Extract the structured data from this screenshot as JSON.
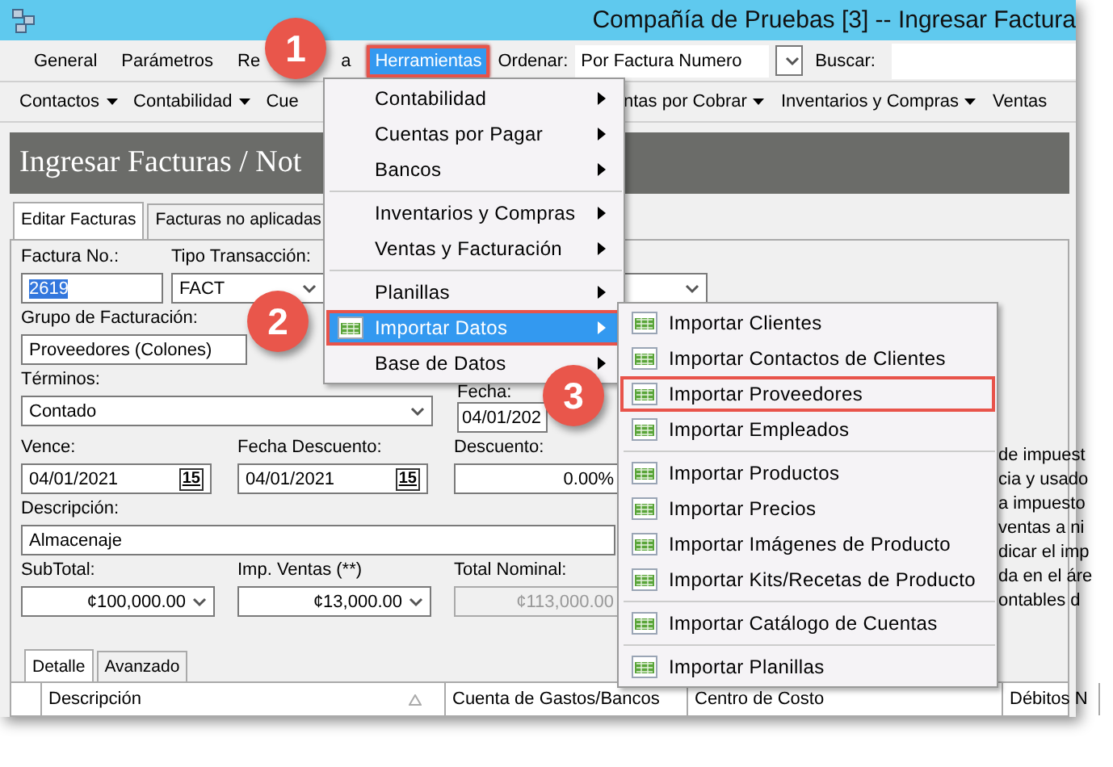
{
  "window": {
    "title": "Compañía de Pruebas [3] -- Ingresar Factura"
  },
  "menu_bar": {
    "items": [
      {
        "label": "General",
        "selected": false,
        "callout": false
      },
      {
        "label": "Parámetros",
        "selected": false,
        "callout": false
      },
      {
        "label": "Re",
        "label_end": "a",
        "selected": false,
        "callout": false
      },
      {
        "label": "Herramientas",
        "selected": true,
        "callout": true
      }
    ],
    "sort_label": "Ordenar:",
    "sort_value": "Por Factura Numero",
    "search_label": "Buscar:"
  },
  "toolbar": {
    "left": [
      "Contactos",
      "Contabilidad",
      "Cue"
    ],
    "right": [
      "ntas por Cobrar",
      "Inventarios y Compras",
      "Ventas"
    ]
  },
  "heading": "Ingresar Facturas / Not",
  "tabs": [
    {
      "label": "Editar Facturas",
      "selected": true
    },
    {
      "label": "Facturas no aplicadas",
      "selected": false
    }
  ],
  "form": {
    "invoice_no": {
      "label": "Factura No.:",
      "value": "2619"
    },
    "transaction_type": {
      "label": "Tipo Transacción:",
      "value": "FACT"
    },
    "billing_group": {
      "label": "Grupo de Facturación:",
      "value": "Proveedores (Colones)"
    },
    "terms": {
      "label": "Términos:",
      "value": "Contado"
    },
    "date": {
      "label": "Fecha:",
      "value": "04/01/202"
    },
    "due": {
      "label": "Vence:",
      "value": "04/01/2021",
      "calendar": "15"
    },
    "discount_date": {
      "label": "Fecha Descuento:",
      "value": "04/01/2021",
      "calendar": "15"
    },
    "discount": {
      "label": "Descuento:",
      "value": "0.00%"
    },
    "description": {
      "label": "Descripción:",
      "value": "Almacenaje"
    },
    "subtotal": {
      "label": "SubTotal:",
      "value": "¢100,000.00"
    },
    "sales_tax": {
      "label": "Imp. Ventas (**)",
      "value": "¢13,000.00"
    },
    "total": {
      "label": "Total Nominal:",
      "value": "¢113,000.00",
      "disabled": true
    }
  },
  "help_text": [
    "de impuest",
    "cia y usado",
    "a impuesto",
    "ventas a ni",
    "dicar el imp",
    "da en el áre",
    "ontables d"
  ],
  "detail_tabs": [
    {
      "label": "Detalle",
      "selected": true
    },
    {
      "label": "Avanzado",
      "selected": false
    }
  ],
  "grid": {
    "columns": [
      "Descripción",
      "Cuenta de Gastos/Bancos",
      "Centro de Costo",
      "Débitos N"
    ]
  },
  "tools_menu": [
    {
      "kind": "item",
      "label": "Contabilidad",
      "selected": false,
      "callout": false
    },
    {
      "kind": "item",
      "label": "Cuentas por Pagar",
      "selected": false,
      "callout": false
    },
    {
      "kind": "item",
      "label": "Bancos",
      "selected": false,
      "callout": false
    },
    {
      "kind": "separator"
    },
    {
      "kind": "item",
      "label": "Inventarios y Compras",
      "selected": false,
      "callout": false
    },
    {
      "kind": "item",
      "label": "Ventas y Facturación",
      "selected": false,
      "callout": false
    },
    {
      "kind": "separator"
    },
    {
      "kind": "item",
      "label": "Planillas",
      "selected": false,
      "callout": false
    },
    {
      "kind": "icon_item",
      "label": "Importar Datos",
      "selected": true,
      "callout": true
    },
    {
      "kind": "item",
      "label": "Base de Datos",
      "selected": false,
      "callout": false
    }
  ],
  "import_menu": [
    {
      "kind": "icon_item",
      "label": "Importar Clientes",
      "callout": false
    },
    {
      "kind": "icon_item",
      "label": "Importar Contactos de Clientes",
      "callout": false
    },
    {
      "kind": "icon_item",
      "label": "Importar Proveedores",
      "callout": true
    },
    {
      "kind": "icon_item",
      "label": "Importar Empleados",
      "callout": false
    },
    {
      "kind": "separator"
    },
    {
      "kind": "icon_item",
      "label": "Importar Productos",
      "callout": false
    },
    {
      "kind": "icon_item",
      "label": "Importar Precios",
      "callout": false
    },
    {
      "kind": "icon_item",
      "label": "Importar Imágenes de Producto",
      "callout": false
    },
    {
      "kind": "icon_item",
      "label": "Importar Kits/Recetas de Producto",
      "callout": false
    },
    {
      "kind": "separator"
    },
    {
      "kind": "icon_item",
      "label": "Importar Catálogo de Cuentas",
      "callout": false
    },
    {
      "kind": "separator"
    },
    {
      "kind": "icon_item",
      "label": "Importar Planillas",
      "callout": false
    }
  ],
  "callouts": [
    "1",
    "2",
    "3"
  ]
}
